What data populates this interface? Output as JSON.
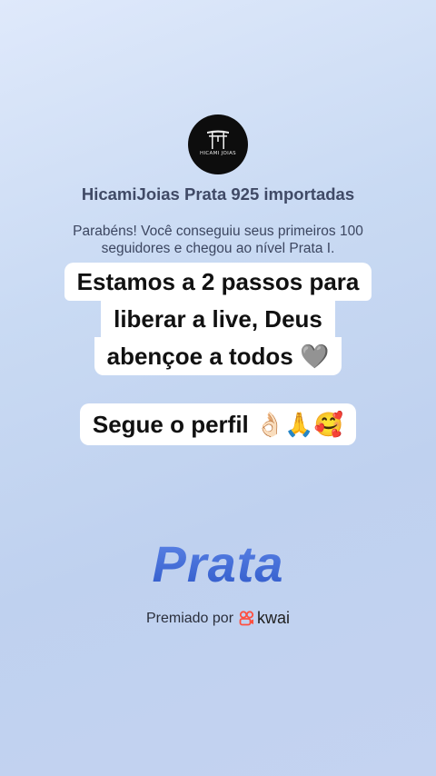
{
  "logo": {
    "text": "HICAMI JOIAS"
  },
  "store_name": "HicamiJoias Prata 925 importadas",
  "congrats": {
    "line1": "Parabéns! Você conseguiu seus primeiros 100",
    "line2": "seguidores e chegou ao nível Prata I."
  },
  "caption": {
    "line1": "Estamos a 2 passos para",
    "line2": "liberar a live, Deus",
    "line3": "abençoe a todos 🩶",
    "line4": "Segue o perfil 👌🏻🙏🥰"
  },
  "tier": "Prata",
  "awarded": {
    "label": "Premiado por",
    "brand": "kwai"
  },
  "colors": {
    "tier_accent": "#3a63d3",
    "kwai_brand": "#ff4f3f"
  }
}
